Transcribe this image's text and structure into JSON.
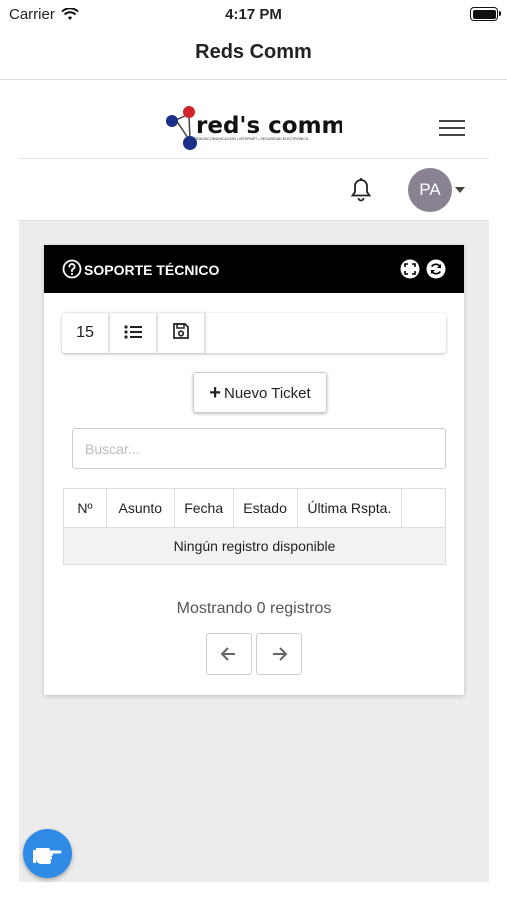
{
  "status": {
    "carrier": "Carrier",
    "time": "4:17 PM"
  },
  "navbar": {
    "title": "Reds Comm"
  },
  "brand": {
    "logo_text": "red's comm",
    "tagline": "RADIOCOMUNICACIÓN • INTERNET • SEGURIDAD ELECTRÓNICA"
  },
  "user": {
    "initials": "PA"
  },
  "card": {
    "title": "SOPORTE TÉCNICO",
    "page_size": "15",
    "new_ticket": "Nuevo Ticket",
    "search_placeholder": "Buscar...",
    "columns": [
      "Nº",
      "Asunto",
      "Fecha",
      "Estado",
      "Última Rspta.",
      ""
    ],
    "empty": "Ningún registro disponible",
    "showing": "Mostrando 0 registros"
  },
  "colors": {
    "header": "#000000",
    "avatar": "#8a8291",
    "fab": "#2f8be6",
    "logo_red": "#d0242c",
    "logo_blue": "#1a2f8a"
  },
  "icons": [
    "wifi-icon",
    "battery-icon",
    "hamburger-icon",
    "bell-icon",
    "question-icon",
    "fullscreen-icon",
    "refresh-icon",
    "list-icon",
    "save-icon",
    "plus-icon",
    "arrow-left-icon",
    "arrow-right-icon",
    "hand-pointer-icon"
  ]
}
